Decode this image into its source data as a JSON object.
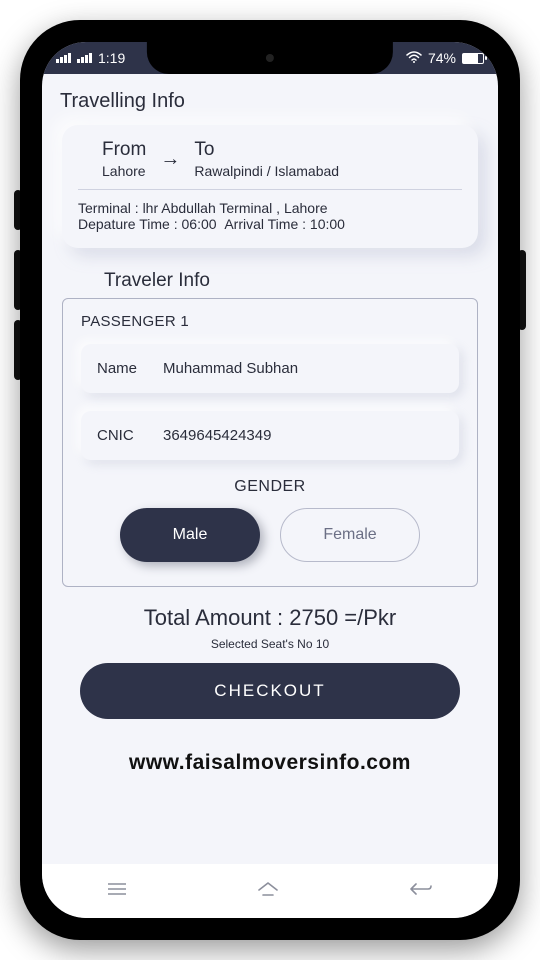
{
  "status": {
    "time": "1:19",
    "battery_pct": "74%"
  },
  "titles": {
    "travelling": "Travelling Info",
    "traveler": "Traveler Info"
  },
  "route": {
    "from_label": "From",
    "from_value": "Lahore",
    "to_label": "To",
    "to_value": "Rawalpindi / Islamabad",
    "terminal_line": "Terminal : lhr Abdullah Terminal , Lahore",
    "depart_label": "Depature Time :",
    "depart_value": "06:00",
    "arrive_label": "Arrival Time :",
    "arrive_value": "10:00"
  },
  "passenger": {
    "heading": "PASSENGER 1",
    "name_label": "Name",
    "name_value": "Muhammad Subhan",
    "cnic_label": "CNIC",
    "cnic_value": "3649645424349",
    "gender_label": "GENDER",
    "male_label": "Male",
    "female_label": "Female",
    "selected_gender": "Male"
  },
  "totals": {
    "amount_line": "Total Amount : 2750 =/Pkr",
    "seat_line": "Selected Seat's No  10"
  },
  "actions": {
    "checkout": "CHECKOUT"
  },
  "footer": {
    "site": "www.faisalmoversinfo.com"
  }
}
